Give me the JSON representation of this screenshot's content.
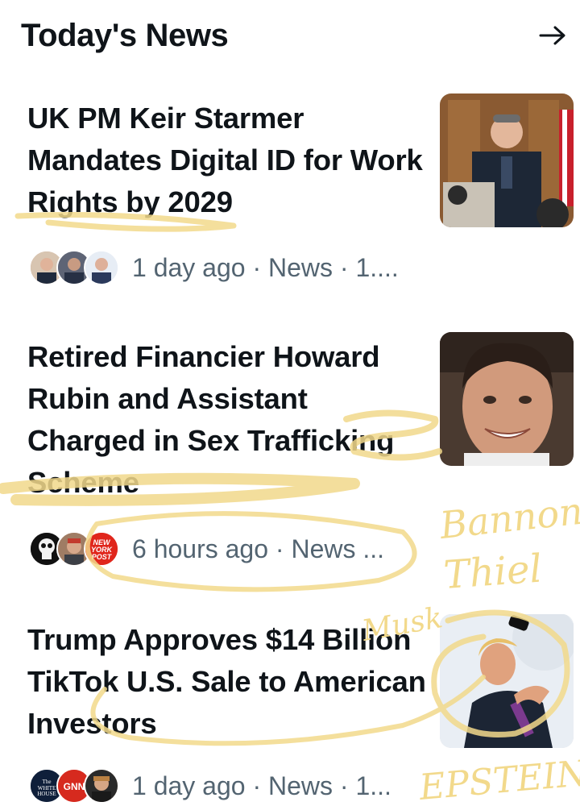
{
  "header": {
    "title": "Today's News",
    "arrow_icon": "arrow-right-icon"
  },
  "stories": [
    {
      "headline": "UK PM Keir Starmer Mandates Digital ID for Work Rights by 2029",
      "meta": "1 day ago · News · 1....",
      "thumbnail_icon": "press-conference-photo"
    },
    {
      "headline": "Retired Financier Howard Rubin and Assistant Charged in Sex Trafficking Scheme",
      "meta": "6 hours ago · News ...",
      "thumbnail_icon": "portrait-photo",
      "avatar_badges": {
        "newspaper": "NEW YORK POST"
      }
    },
    {
      "headline": "Trump Approves $14 Billion TikTok U.S. Sale to American Investors",
      "meta": "1 day ago · News · 1...",
      "thumbnail_icon": "speaker-photo",
      "avatar_badges": {
        "house": "The WHITE HOUSE",
        "network": "GNN"
      }
    }
  ],
  "annotations": {
    "names": [
      "Bannon",
      "Thiel",
      "Musk",
      "EPSTEIN"
    ],
    "highlight_color": "#f2d98b"
  }
}
